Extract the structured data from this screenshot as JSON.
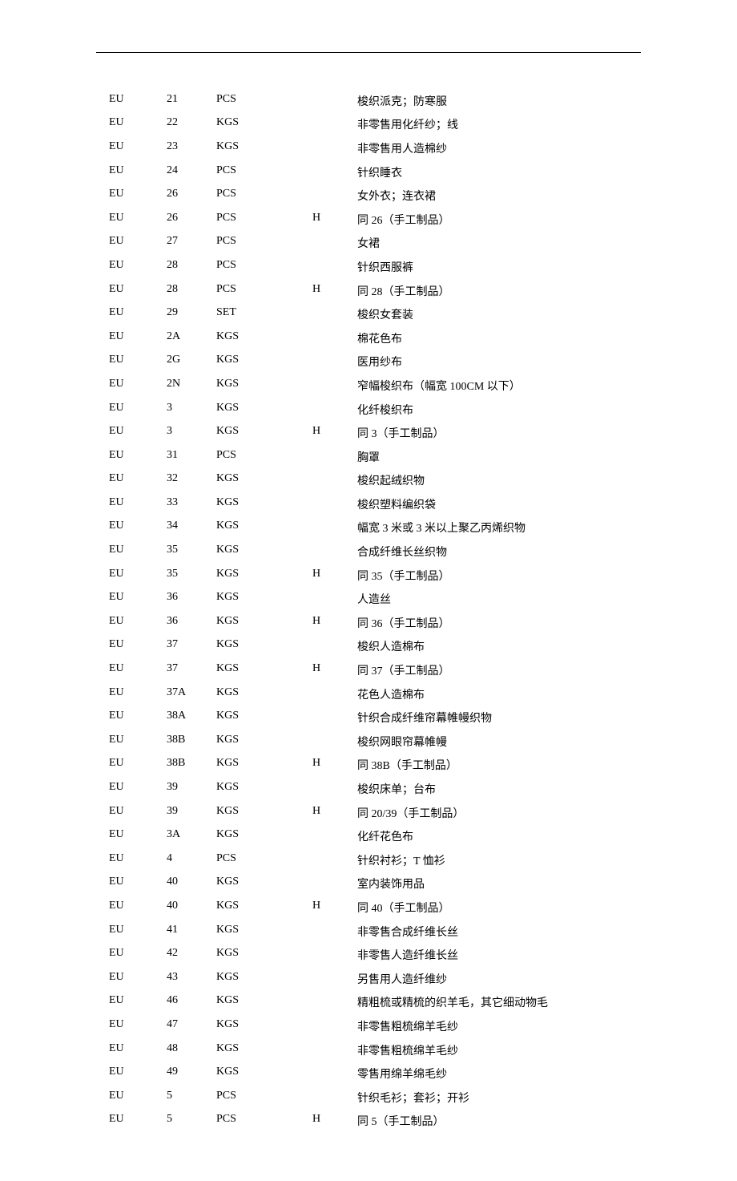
{
  "rows": [
    {
      "region": "EU",
      "code": "21",
      "unit": "PCS",
      "flag": "",
      "desc": "梭织派克；防寒服"
    },
    {
      "region": "EU",
      "code": "22",
      "unit": "KGS",
      "flag": "",
      "desc": "非零售用化纤纱；线"
    },
    {
      "region": "EU",
      "code": "23",
      "unit": "KGS",
      "flag": "",
      "desc": "非零售用人造棉纱"
    },
    {
      "region": "EU",
      "code": "24",
      "unit": "PCS",
      "flag": "",
      "desc": "针织睡衣"
    },
    {
      "region": "EU",
      "code": "26",
      "unit": "PCS",
      "flag": "",
      "desc": "女外衣；连衣裙"
    },
    {
      "region": "EU",
      "code": "26",
      "unit": "PCS",
      "flag": "H",
      "desc": "同 26（手工制品）"
    },
    {
      "region": "EU",
      "code": "27",
      "unit": "PCS",
      "flag": "",
      "desc": "女裙"
    },
    {
      "region": "EU",
      "code": "28",
      "unit": "PCS",
      "flag": "",
      "desc": "针织西服裤"
    },
    {
      "region": "EU",
      "code": "28",
      "unit": "PCS",
      "flag": "H",
      "desc": "同 28（手工制品）"
    },
    {
      "region": "EU",
      "code": "29",
      "unit": "SET",
      "flag": "",
      "desc": "梭织女套装"
    },
    {
      "region": "EU",
      "code": "2A",
      "unit": "KGS",
      "flag": "",
      "desc": "棉花色布"
    },
    {
      "region": "EU",
      "code": "2G",
      "unit": "KGS",
      "flag": "",
      "desc": "医用纱布"
    },
    {
      "region": "EU",
      "code": "2N",
      "unit": "KGS",
      "flag": "",
      "desc": "窄幅梭织布（幅宽 100CM 以下）"
    },
    {
      "region": "EU",
      "code": "3",
      "unit": "KGS",
      "flag": "",
      "desc": "化纤梭织布"
    },
    {
      "region": "EU",
      "code": "3",
      "unit": "KGS",
      "flag": "H",
      "desc": "同 3（手工制品）"
    },
    {
      "region": "EU",
      "code": "31",
      "unit": "PCS",
      "flag": "",
      "desc": "胸罩"
    },
    {
      "region": "EU",
      "code": "32",
      "unit": "KGS",
      "flag": "",
      "desc": "梭织起绒织物"
    },
    {
      "region": "EU",
      "code": "33",
      "unit": "KGS",
      "flag": "",
      "desc": "梭织塑料编织袋"
    },
    {
      "region": "EU",
      "code": "34",
      "unit": "KGS",
      "flag": "",
      "desc": "幅宽 3 米或 3 米以上聚乙丙烯织物"
    },
    {
      "region": "EU",
      "code": "35",
      "unit": "KGS",
      "flag": "",
      "desc": "合成纤维长丝织物"
    },
    {
      "region": "EU",
      "code": "35",
      "unit": "KGS",
      "flag": "H",
      "desc": "同 35（手工制品）"
    },
    {
      "region": "EU",
      "code": "36",
      "unit": "KGS",
      "flag": "",
      "desc": "人造丝"
    },
    {
      "region": "EU",
      "code": "36",
      "unit": "KGS",
      "flag": "H",
      "desc": "同 36（手工制品）"
    },
    {
      "region": "EU",
      "code": "37",
      "unit": "KGS",
      "flag": "",
      "desc": "梭织人造棉布"
    },
    {
      "region": "EU",
      "code": "37",
      "unit": "KGS",
      "flag": "H",
      "desc": "同 37（手工制品）"
    },
    {
      "region": "EU",
      "code": "37A",
      "unit": "KGS",
      "flag": "",
      "desc": "花色人造棉布"
    },
    {
      "region": "EU",
      "code": "38A",
      "unit": "KGS",
      "flag": "",
      "desc": "针织合成纤维帘幕帷幔织物"
    },
    {
      "region": "EU",
      "code": "38B",
      "unit": "KGS",
      "flag": "",
      "desc": "梭织网眼帘幕帷幔"
    },
    {
      "region": "EU",
      "code": "38B",
      "unit": "KGS",
      "flag": "H",
      "desc": "同 38B（手工制品）"
    },
    {
      "region": "EU",
      "code": "39",
      "unit": "KGS",
      "flag": "",
      "desc": "梭织床单；台布"
    },
    {
      "region": "EU",
      "code": "39",
      "unit": "KGS",
      "flag": "H",
      "desc": "同 20/39（手工制品）"
    },
    {
      "region": "EU",
      "code": "3A",
      "unit": "KGS",
      "flag": "",
      "desc": "化纤花色布"
    },
    {
      "region": "EU",
      "code": "4",
      "unit": "PCS",
      "flag": "",
      "desc": "针织衬衫；T 恤衫"
    },
    {
      "region": "EU",
      "code": "40",
      "unit": "KGS",
      "flag": "",
      "desc": "室内装饰用品"
    },
    {
      "region": "EU",
      "code": "40",
      "unit": "KGS",
      "flag": "H",
      "desc": "同 40（手工制品）"
    },
    {
      "region": "EU",
      "code": "41",
      "unit": "KGS",
      "flag": "",
      "desc": "非零售合成纤维长丝"
    },
    {
      "region": "EU",
      "code": "42",
      "unit": "KGS",
      "flag": "",
      "desc": "非零售人造纤维长丝"
    },
    {
      "region": "EU",
      "code": "43",
      "unit": "KGS",
      "flag": "",
      "desc": "另售用人造纤维纱"
    },
    {
      "region": "EU",
      "code": "46",
      "unit": "KGS",
      "flag": "",
      "desc": "精粗梳或精梳的织羊毛，其它细动物毛"
    },
    {
      "region": "EU",
      "code": "47",
      "unit": "KGS",
      "flag": "",
      "desc": "非零售粗梳绵羊毛纱"
    },
    {
      "region": "EU",
      "code": "48",
      "unit": "KGS",
      "flag": "",
      "desc": "非零售粗梳绵羊毛纱"
    },
    {
      "region": "EU",
      "code": "49",
      "unit": "KGS",
      "flag": "",
      "desc": "零售用绵羊绵毛纱"
    },
    {
      "region": "EU",
      "code": "5",
      "unit": "PCS",
      "flag": "",
      "desc": "针织毛衫；套衫；开衫"
    },
    {
      "region": "EU",
      "code": "5",
      "unit": "PCS",
      "flag": "H",
      "desc": "同 5（手工制品）"
    }
  ]
}
